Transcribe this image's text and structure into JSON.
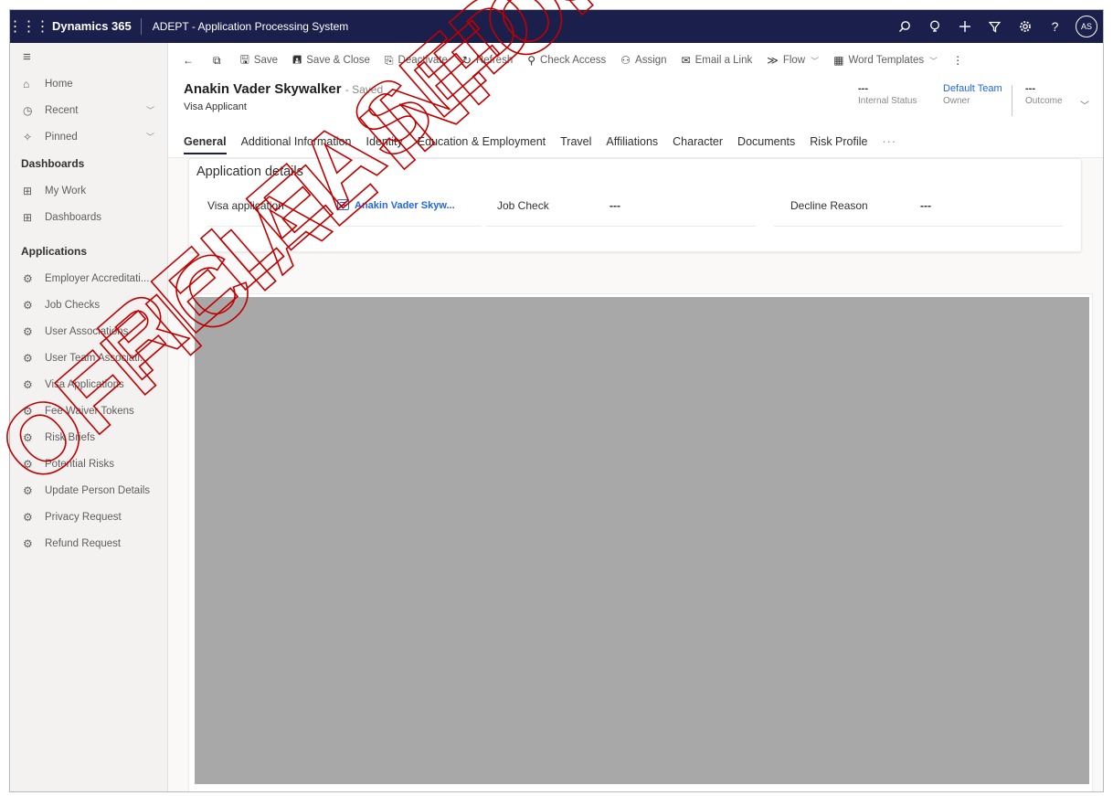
{
  "topbar": {
    "brand": "Dynamics 365",
    "app_name": "ADEPT - Application Processing System",
    "avatar_initials": "AS"
  },
  "nav": {
    "top_items": [
      {
        "label": "Home",
        "icon": "home-icon"
      },
      {
        "label": "Recent",
        "icon": "clock-icon"
      },
      {
        "label": "Pinned",
        "icon": "pin-icon"
      }
    ],
    "dashboards_group": "Dashboards",
    "dashboard_items": [
      {
        "label": "My Work",
        "icon": "dashboard-icon"
      },
      {
        "label": "Dashboards",
        "icon": "dashboard-icon"
      }
    ],
    "applications_group": "Applications",
    "application_items": [
      {
        "label": "Employer Accreditati..."
      },
      {
        "label": "Job Checks"
      },
      {
        "label": "User Associations"
      },
      {
        "label": "User Team Associati..."
      },
      {
        "label": "Visa Applications"
      },
      {
        "label": "Fee Waiver Tokens"
      },
      {
        "label": "Risk Briefs"
      },
      {
        "label": "Potential Risks"
      },
      {
        "label": "Update Person Details"
      },
      {
        "label": "Privacy Request"
      },
      {
        "label": "Refund Request"
      }
    ]
  },
  "commands": {
    "save": "Save",
    "save_close": "Save & Close",
    "deactivate": "Deactivate",
    "refresh": "Refresh",
    "check_access": "Check Access",
    "assign": "Assign",
    "email_link": "Email a Link",
    "flow": "Flow",
    "word_templates": "Word Templates"
  },
  "record": {
    "title": "Anakin Vader Skywalker",
    "saved_status": "- Saved",
    "entity": "Visa Applicant",
    "header_fields": [
      {
        "value": "---",
        "label": "Internal Status"
      },
      {
        "value": "Default Team",
        "label": "Owner"
      },
      {
        "value": "---",
        "label": "Outcome"
      }
    ]
  },
  "tabs": [
    "General",
    "Additional Information",
    "Identity",
    "Education & Employment",
    "Travel",
    "Affiliations",
    "Character",
    "Documents",
    "Risk Profile",
    "···"
  ],
  "section": {
    "title": "Application details",
    "fields": {
      "visa_label": "Visa application",
      "visa_value": "Anakin Vader Skyw...",
      "job_label": "Job Check",
      "job_value": "---",
      "decline_label": "Decline Reason",
      "decline_value": "---"
    }
  },
  "watermark": {
    "line1": "RELEASED UNDER",
    "line2": "OFFICIAL INFORMATION",
    "color": "#c00000"
  },
  "colors": {
    "topbar": "#1b1f4b",
    "link": "#2266e3",
    "redacted": "#a8a8a8"
  }
}
